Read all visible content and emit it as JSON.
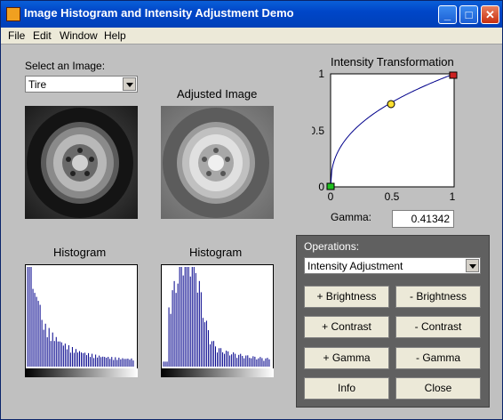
{
  "window": {
    "title": "Image Histogram and Intensity Adjustment Demo"
  },
  "menu": [
    "File",
    "Edit",
    "Window",
    "Help"
  ],
  "title_buttons": {
    "minimize": "_",
    "maximize": "□",
    "close": "✕"
  },
  "left": {
    "select_label": "Select an Image:",
    "image_select": "Tire",
    "adjusted_label": "Adjusted Image",
    "hist1_label": "Histogram",
    "hist2_label": "Histogram"
  },
  "transform": {
    "title": "Intensity Transformation",
    "y_ticks": [
      "1",
      "0.5",
      "0"
    ],
    "x_ticks": [
      "0",
      "0.5",
      "1"
    ],
    "gamma_label": "Gamma:",
    "gamma_value": "0.41342"
  },
  "operations": {
    "title": "Operations:",
    "select": "Intensity Adjustment",
    "buttons": [
      "+ Brightness",
      "- Brightness",
      "+ Contrast",
      "- Contrast",
      "+ Gamma",
      "- Gamma",
      "Info",
      "Close"
    ]
  },
  "colors": {
    "curve": "#00008b",
    "histogram_bars": "#00008b",
    "mid_point": "#ffe030",
    "end_point": "#cc2020",
    "start_point": "#20c020"
  }
}
